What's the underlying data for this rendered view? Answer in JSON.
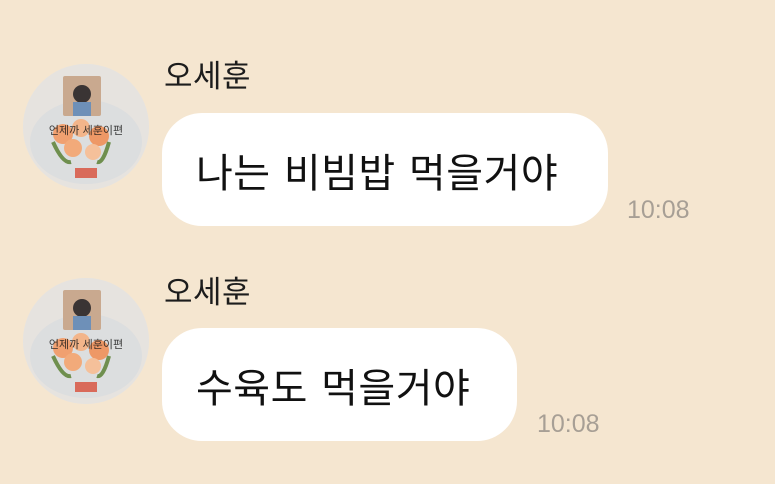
{
  "messages": [
    {
      "sender": "오세훈",
      "text": "나는 비빔밥 먹을거야",
      "time": "10:08",
      "avatar_caption": "언제까 세훈이편"
    },
    {
      "sender": "오세훈",
      "text": "수육도 먹을거야",
      "time": "10:08",
      "avatar_caption": "언제까 세훈이편"
    }
  ],
  "colors": {
    "background": "#f5e6d0",
    "bubble": "#ffffff",
    "time": "#a79f95"
  }
}
